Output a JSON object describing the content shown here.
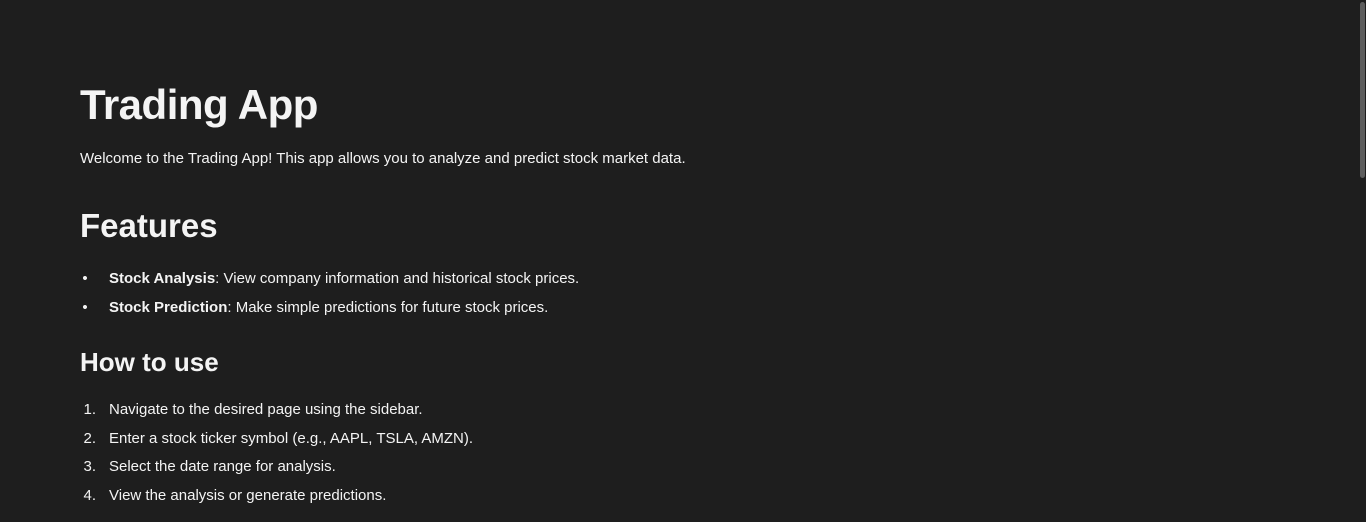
{
  "page": {
    "title": "Trading App",
    "intro": "Welcome to the Trading App! This app allows you to analyze and predict stock market data."
  },
  "features": {
    "heading": "Features",
    "bullet": "•",
    "items": [
      {
        "name": "Stock Analysis",
        "desc": ": View company information and historical stock prices."
      },
      {
        "name": "Stock Prediction",
        "desc": ": Make simple predictions for future stock prices."
      }
    ]
  },
  "how_to_use": {
    "heading": "How to use",
    "steps": [
      {
        "num": "1.",
        "text": "Navigate to the desired page using the sidebar."
      },
      {
        "num": "2.",
        "text": "Enter a stock ticker symbol (e.g., AAPL, TSLA, AMZN)."
      },
      {
        "num": "3.",
        "text": "Select the date range for analysis."
      },
      {
        "num": "4.",
        "text": "View the analysis or generate predictions."
      }
    ]
  },
  "colors": {
    "background": "#1e1e1e",
    "text": "#f4f4f4",
    "scrollbar_thumb": "#5d5d5d"
  }
}
